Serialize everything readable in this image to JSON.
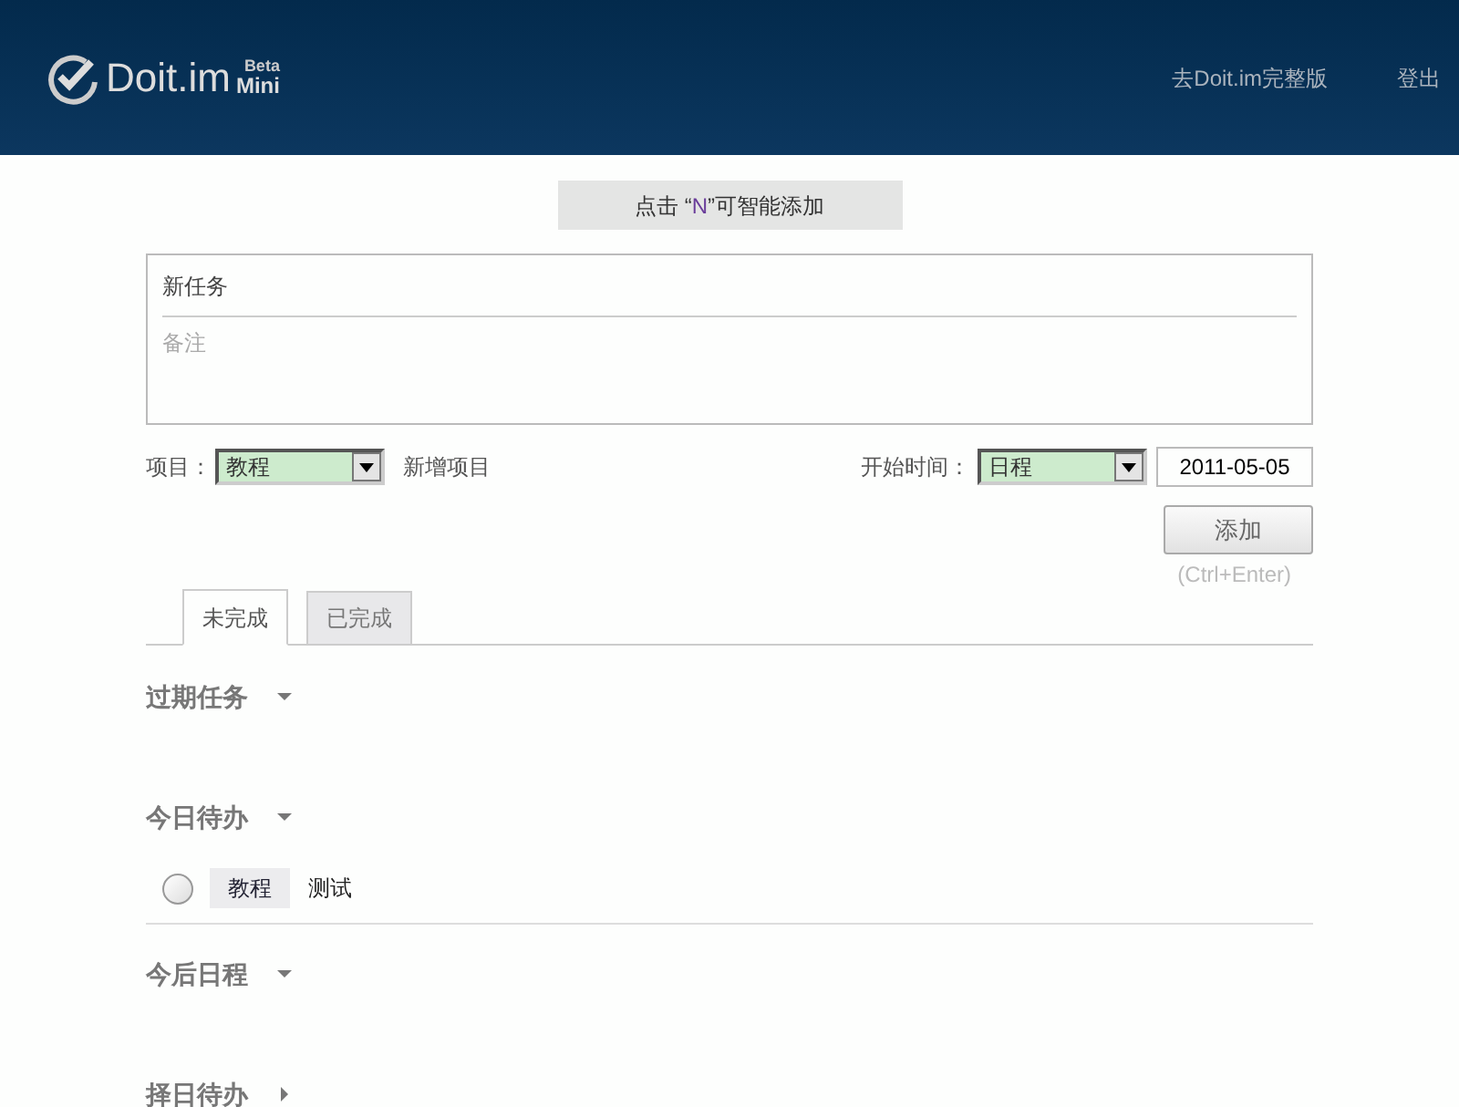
{
  "header": {
    "logo": {
      "name": "Doit.im",
      "badge_top": "Beta",
      "badge_bottom": "Mini"
    },
    "links": [
      "去Doit.im完整版",
      "登出"
    ]
  },
  "hint": {
    "before": "点击 “",
    "key": "N",
    "after": "”可智能添加"
  },
  "new_task": {
    "title_placeholder": "新任务",
    "note_placeholder": "备注"
  },
  "project": {
    "label": "项目：",
    "value": "教程",
    "add_link": "新增项目"
  },
  "start": {
    "label": "开始时间：",
    "value": "日程",
    "date": "2011-05-05"
  },
  "add_button": "添加",
  "shortcut": "(Ctrl+Enter)",
  "tabs": [
    {
      "label": "未完成",
      "selected": true
    },
    {
      "label": "已完成",
      "selected": false
    }
  ],
  "sections": [
    {
      "title": "过期任务",
      "expanded": true
    },
    {
      "title": "今日待办",
      "expanded": true,
      "tasks": [
        {
          "project": "教程",
          "title": "测试",
          "checked": false
        }
      ]
    },
    {
      "title": "今后日程",
      "expanded": true
    },
    {
      "title": "择日待办",
      "expanded": false
    }
  ]
}
